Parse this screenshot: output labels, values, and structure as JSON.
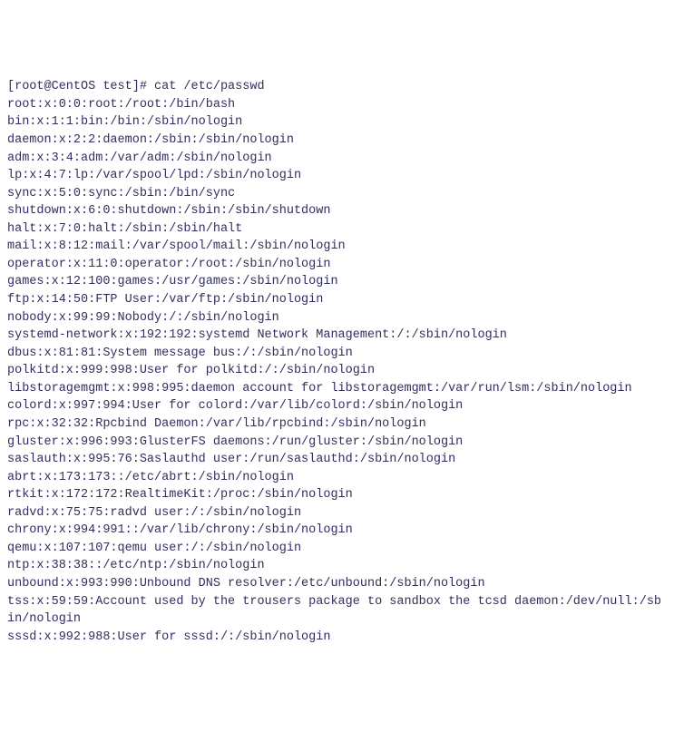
{
  "prompt": "[root@CentOS test]# cat /etc/passwd",
  "lines": [
    "root:x:0:0:root:/root:/bin/bash",
    "bin:x:1:1:bin:/bin:/sbin/nologin",
    "daemon:x:2:2:daemon:/sbin:/sbin/nologin",
    "adm:x:3:4:adm:/var/adm:/sbin/nologin",
    "lp:x:4:7:lp:/var/spool/lpd:/sbin/nologin",
    "sync:x:5:0:sync:/sbin:/bin/sync",
    "shutdown:x:6:0:shutdown:/sbin:/sbin/shutdown",
    "halt:x:7:0:halt:/sbin:/sbin/halt",
    "mail:x:8:12:mail:/var/spool/mail:/sbin/nologin",
    "operator:x:11:0:operator:/root:/sbin/nologin",
    "games:x:12:100:games:/usr/games:/sbin/nologin",
    "ftp:x:14:50:FTP User:/var/ftp:/sbin/nologin",
    "nobody:x:99:99:Nobody:/:/sbin/nologin",
    "systemd-network:x:192:192:systemd Network Management:/:/sbin/nologin",
    "dbus:x:81:81:System message bus:/:/sbin/nologin",
    "polkitd:x:999:998:User for polkitd:/:/sbin/nologin",
    "libstoragemgmt:x:998:995:daemon account for libstoragemgmt:/var/run/lsm:/sbin/nologin",
    "colord:x:997:994:User for colord:/var/lib/colord:/sbin/nologin",
    "rpc:x:32:32:Rpcbind Daemon:/var/lib/rpcbind:/sbin/nologin",
    "gluster:x:996:993:GlusterFS daemons:/run/gluster:/sbin/nologin",
    "saslauth:x:995:76:Saslauthd user:/run/saslauthd:/sbin/nologin",
    "abrt:x:173:173::/etc/abrt:/sbin/nologin",
    "rtkit:x:172:172:RealtimeKit:/proc:/sbin/nologin",
    "radvd:x:75:75:radvd user:/:/sbin/nologin",
    "chrony:x:994:991::/var/lib/chrony:/sbin/nologin",
    "qemu:x:107:107:qemu user:/:/sbin/nologin",
    "ntp:x:38:38::/etc/ntp:/sbin/nologin",
    "unbound:x:993:990:Unbound DNS resolver:/etc/unbound:/sbin/nologin",
    "tss:x:59:59:Account used by the trousers package to sandbox the tcsd daemon:/dev/null:/sbin/nologin",
    "sssd:x:992:988:User for sssd:/:/sbin/nologin"
  ]
}
